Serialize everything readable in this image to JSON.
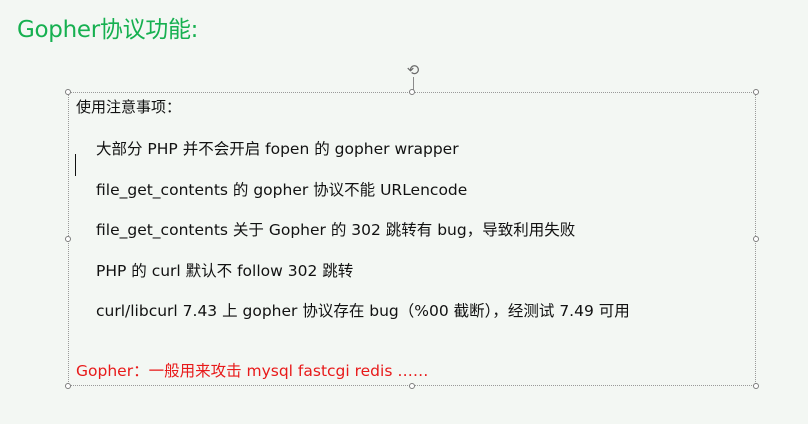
{
  "slide": {
    "title": "Gopher协议功能:",
    "heading": "使用注意事项：",
    "items": [
      "大部分 PHP 并不会开启 fopen 的 gopher wrapper",
      "file_get_contents 的 gopher 协议不能 URLencode",
      "file_get_contents 关于 Gopher 的 302 跳转有 bug，导致利用失败",
      "PHP 的 curl 默认不 follow 302 跳转",
      "curl/libcurl 7.43 上 gopher 协议存在 bug（%00 截断），经测试 7.49 可用"
    ],
    "footer": "Gopher：一般用来攻击 mysql fastcgi redis ……"
  },
  "colors": {
    "title": "#16b050",
    "footer": "#e81a1a",
    "background": "#f3f7f3"
  },
  "icons": {
    "rotate_handle": "rotate-icon"
  }
}
